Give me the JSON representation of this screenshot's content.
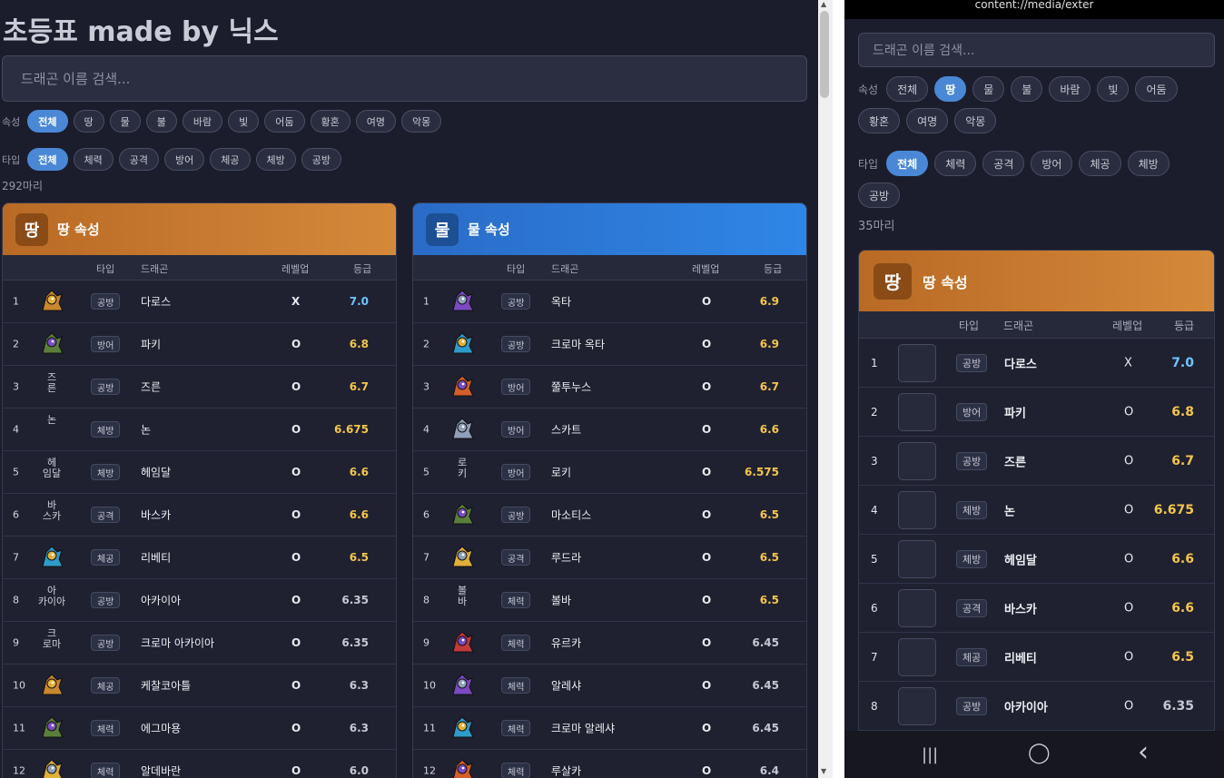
{
  "desktop": {
    "title": "초등표 made by 닉스",
    "search_placeholder": "드래곤 이름 검색...",
    "attr_label": "속성",
    "attr_chips": [
      "전체",
      "땅",
      "물",
      "불",
      "바람",
      "빛",
      "어둠",
      "황혼",
      "여명",
      "악몽"
    ],
    "type_label": "타입",
    "type_chips": [
      "전체",
      "체력",
      "공격",
      "방어",
      "체공",
      "체방",
      "공방"
    ],
    "count": "292마리",
    "headers": {
      "type": "타입",
      "dragon": "드래곤",
      "levelup": "레벨업",
      "grade": "등급"
    },
    "earth": {
      "badge": "땅",
      "title": "땅 속성",
      "rows": [
        {
          "rank": "1",
          "icon": "dragon-icon",
          "type": "공방",
          "name": "다로스",
          "lv": "X",
          "grade": "7.0",
          "tier": "blue"
        },
        {
          "rank": "2",
          "icon": "dragon-icon",
          "type": "방어",
          "name": "파키",
          "lv": "O",
          "grade": "6.8",
          "tier": "gold"
        },
        {
          "rank": "3",
          "broken": "즈\n른",
          "type": "공방",
          "name": "즈른",
          "lv": "O",
          "grade": "6.7",
          "tier": "gold"
        },
        {
          "rank": "4",
          "broken": "논",
          "type": "체방",
          "name": "논",
          "lv": "O",
          "grade": "6.675",
          "tier": "gold"
        },
        {
          "rank": "5",
          "broken": "헤\n임달",
          "type": "체방",
          "name": "헤임달",
          "lv": "O",
          "grade": "6.6",
          "tier": "gold"
        },
        {
          "rank": "6",
          "broken": "바\n스카",
          "type": "공격",
          "name": "바스카",
          "lv": "O",
          "grade": "6.6",
          "tier": "gold"
        },
        {
          "rank": "7",
          "icon": "dragon-icon",
          "type": "체공",
          "name": "리베티",
          "lv": "O",
          "grade": "6.5",
          "tier": "gold"
        },
        {
          "rank": "8",
          "broken": "아\n카이아",
          "type": "공방",
          "name": "아카이아",
          "lv": "O",
          "grade": "6.35",
          "tier": "gray"
        },
        {
          "rank": "9",
          "broken": "크\n로마",
          "type": "공방",
          "name": "크로마 아카이아",
          "lv": "O",
          "grade": "6.35",
          "tier": "gray"
        },
        {
          "rank": "10",
          "icon": "dragon-icon",
          "type": "체공",
          "name": "케찰코아틀",
          "lv": "O",
          "grade": "6.3",
          "tier": "gray"
        },
        {
          "rank": "11",
          "icon": "dragon-icon",
          "type": "체력",
          "name": "에그마용",
          "lv": "O",
          "grade": "6.3",
          "tier": "gray"
        },
        {
          "rank": "12",
          "icon": "dragon-icon",
          "type": "체력",
          "name": "알데바란",
          "lv": "O",
          "grade": "6.0",
          "tier": "gray"
        }
      ]
    },
    "water": {
      "badge": "물",
      "title": "물 속성",
      "rows": [
        {
          "rank": "1",
          "icon": "dragon-icon",
          "type": "공방",
          "name": "옥타",
          "lv": "O",
          "grade": "6.9",
          "tier": "gold"
        },
        {
          "rank": "2",
          "icon": "dragon-icon",
          "type": "공방",
          "name": "크로마 옥타",
          "lv": "O",
          "grade": "6.9",
          "tier": "gold"
        },
        {
          "rank": "3",
          "icon": "dragon-icon",
          "type": "방어",
          "name": "쭐투누스",
          "lv": "O",
          "grade": "6.7",
          "tier": "gold"
        },
        {
          "rank": "4",
          "icon": "dragon-icon",
          "type": "방어",
          "name": "스카트",
          "lv": "O",
          "grade": "6.6",
          "tier": "gold"
        },
        {
          "rank": "5",
          "broken": "로\n키",
          "type": "방어",
          "name": "로키",
          "lv": "O",
          "grade": "6.575",
          "tier": "gold"
        },
        {
          "rank": "6",
          "icon": "dragon-icon",
          "type": "공방",
          "name": "마소티스",
          "lv": "O",
          "grade": "6.5",
          "tier": "gold"
        },
        {
          "rank": "7",
          "icon": "dragon-icon",
          "type": "공격",
          "name": "루드라",
          "lv": "O",
          "grade": "6.5",
          "tier": "gold"
        },
        {
          "rank": "8",
          "broken": "볼\n바",
          "type": "체력",
          "name": "볼바",
          "lv": "O",
          "grade": "6.5",
          "tier": "gold"
        },
        {
          "rank": "9",
          "icon": "dragon-icon",
          "type": "체력",
          "name": "유르카",
          "lv": "O",
          "grade": "6.45",
          "tier": "gray"
        },
        {
          "rank": "10",
          "icon": "dragon-icon",
          "type": "체력",
          "name": "알레샤",
          "lv": "O",
          "grade": "6.45",
          "tier": "gray"
        },
        {
          "rank": "11",
          "icon": "dragon-icon",
          "type": "체력",
          "name": "크로마 알레샤",
          "lv": "O",
          "grade": "6.45",
          "tier": "gray"
        },
        {
          "rank": "12",
          "icon": "dragon-icon",
          "type": "체력",
          "name": "루살카",
          "lv": "O",
          "grade": "6.4",
          "tier": "gray"
        }
      ]
    }
  },
  "mobile": {
    "url": "content://media/exter",
    "search_placeholder": "드래곤 이름 검색...",
    "attr_label": "속성",
    "attr_chips_row1": [
      "전체",
      "땅",
      "물",
      "불",
      "바람",
      "빛",
      "어둠"
    ],
    "attr_chips_row2": [
      "황혼",
      "여명",
      "악몽"
    ],
    "attr_active": "땅",
    "type_label": "타입",
    "type_chips_row1": [
      "전체",
      "체력",
      "공격",
      "방어",
      "체공",
      "체방"
    ],
    "type_chips_row2": [
      "공방"
    ],
    "count": "35마리",
    "panel": {
      "badge": "땅",
      "title": "땅 속성",
      "headers": {
        "type": "타입",
        "dragon": "드래곤",
        "levelup": "레벨업",
        "grade": "등급"
      },
      "rows": [
        {
          "rank": "1",
          "type": "공방",
          "name": "다로스",
          "lv": "X",
          "grade": "7.0",
          "tier": "blue"
        },
        {
          "rank": "2",
          "type": "방어",
          "name": "파키",
          "lv": "O",
          "grade": "6.8",
          "tier": "gold"
        },
        {
          "rank": "3",
          "type": "공방",
          "name": "즈른",
          "lv": "O",
          "grade": "6.7",
          "tier": "gold"
        },
        {
          "rank": "4",
          "type": "체방",
          "name": "논",
          "lv": "O",
          "grade": "6.675",
          "tier": "gold"
        },
        {
          "rank": "5",
          "type": "체방",
          "name": "헤임달",
          "lv": "O",
          "grade": "6.6",
          "tier": "gold"
        },
        {
          "rank": "6",
          "type": "공격",
          "name": "바스카",
          "lv": "O",
          "grade": "6.6",
          "tier": "gold"
        },
        {
          "rank": "7",
          "type": "체공",
          "name": "리베티",
          "lv": "O",
          "grade": "6.5",
          "tier": "gold"
        },
        {
          "rank": "8",
          "type": "공방",
          "name": "아카이아",
          "lv": "O",
          "grade": "6.35",
          "tier": "gray"
        }
      ]
    },
    "nav": {
      "recent": "|||",
      "home": "◯",
      "back": "‹"
    }
  },
  "colors": {
    "background": "#1b1d2d",
    "accent": "#4a88d6",
    "earth": "#d4893a",
    "water": "#2f86e6",
    "grade_blue": "#6fc6ff",
    "grade_gold": "#f5c64a"
  }
}
